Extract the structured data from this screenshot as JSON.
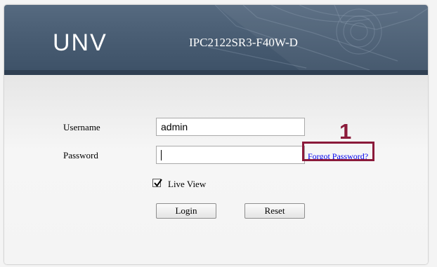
{
  "header": {
    "logo": "UNV",
    "model": "IPC2122SR3-F40W-D"
  },
  "login_form": {
    "username_label": "Username",
    "username_value": "admin",
    "password_label": "Password",
    "password_value": "",
    "forgot_password": "Forgot Password?",
    "live_view_label": "Live View",
    "live_view_checked": true,
    "login_button": "Login",
    "reset_button": "Reset"
  },
  "annotation": {
    "number": "1",
    "color": "#8b1a3a"
  },
  "colors": {
    "header": "#4a5e74",
    "link": "#0000ee"
  }
}
